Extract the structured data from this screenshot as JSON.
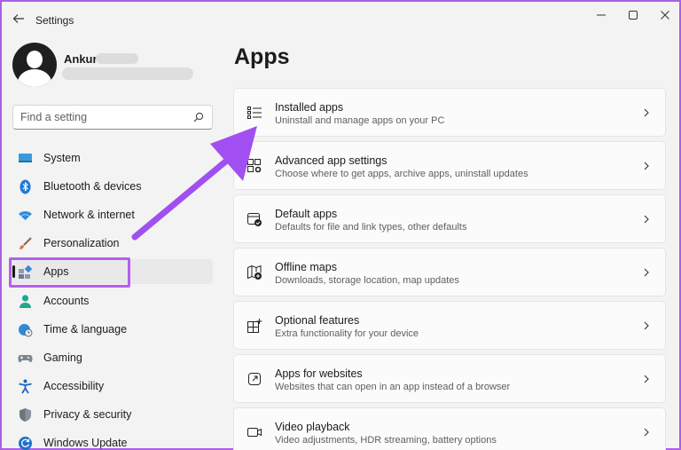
{
  "window": {
    "title": "Settings",
    "back_icon": "back-arrow-icon",
    "controls": [
      "minimize-icon",
      "maximize-icon",
      "close-icon"
    ]
  },
  "user": {
    "name": "Ankur"
  },
  "search": {
    "placeholder": "Find a setting",
    "value": ""
  },
  "sidebar": {
    "selected": "Apps",
    "items": [
      {
        "label": "System",
        "icon": "monitor-icon"
      },
      {
        "label": "Bluetooth & devices",
        "icon": "bluetooth-icon"
      },
      {
        "label": "Network & internet",
        "icon": "wifi-icon"
      },
      {
        "label": "Personalization",
        "icon": "brush-icon"
      },
      {
        "label": "Apps",
        "icon": "apps-icon"
      },
      {
        "label": "Accounts",
        "icon": "person-icon"
      },
      {
        "label": "Time & language",
        "icon": "globe-clock-icon"
      },
      {
        "label": "Gaming",
        "icon": "gamepad-icon"
      },
      {
        "label": "Accessibility",
        "icon": "accessibility-icon"
      },
      {
        "label": "Privacy & security",
        "icon": "shield-icon"
      },
      {
        "label": "Windows Update",
        "icon": "update-icon"
      }
    ]
  },
  "main": {
    "title": "Apps",
    "cards": [
      {
        "title": "Installed apps",
        "subtitle": "Uninstall and manage apps on your PC",
        "icon": "list-icon"
      },
      {
        "title": "Advanced app settings",
        "subtitle": "Choose where to get apps, archive apps, uninstall updates",
        "icon": "app-settings-icon"
      },
      {
        "title": "Default apps",
        "subtitle": "Defaults for file and link types, other defaults",
        "icon": "default-apps-icon"
      },
      {
        "title": "Offline maps",
        "subtitle": "Downloads, storage location, map updates",
        "icon": "map-icon"
      },
      {
        "title": "Optional features",
        "subtitle": "Extra functionality for your device",
        "icon": "optional-features-icon"
      },
      {
        "title": "Apps for websites",
        "subtitle": "Websites that can open in an app instead of a browser",
        "icon": "link-app-icon"
      },
      {
        "title": "Video playback",
        "subtitle": "Video adjustments, HDR streaming, battery options",
        "icon": "video-icon"
      }
    ]
  },
  "colors": {
    "annotation": "#b45ff0",
    "background": "#f3f3f3",
    "card": "#fbfbfb"
  }
}
